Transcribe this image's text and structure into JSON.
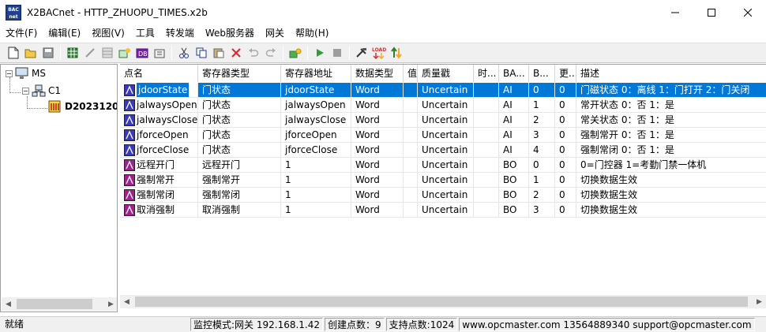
{
  "window": {
    "icon_text": "BAC net",
    "title": "X2BACnet - HTTP_ZHUOPU_TIMES.x2b"
  },
  "menu": [
    "文件(F)",
    "编辑(E)",
    "视图(V)",
    "工具",
    "转发端",
    "Web服务器",
    "网关",
    "帮助(H)"
  ],
  "toolbar_icons": [
    "new-file-icon",
    "open-folder-icon",
    "save-icon",
    "sep",
    "grid-icon",
    "wand-icon",
    "table-icon",
    "add-device-icon",
    "db-icon",
    "export-icon",
    "sep",
    "cut-icon",
    "copy-icon",
    "paste-icon",
    "delete-icon",
    "undo-icon",
    "redo-icon",
    "sep",
    "monitor-icon",
    "sep",
    "run-icon",
    "stop-icon",
    "sep",
    "tools-icon",
    "load-icon",
    "transfer-icon"
  ],
  "colors": {
    "selection": "#0078d7",
    "ai_icon": "#3a3ab8",
    "bo_icon": "#a02090"
  },
  "tree": {
    "root": "MS",
    "channel": "C1",
    "device": "D2023120"
  },
  "grid": {
    "columns": [
      "点名",
      "寄存器类型",
      "寄存器地址",
      "数据类型",
      "值",
      "质量戳",
      "时...",
      "BA...",
      "B...",
      "更...",
      "描述"
    ],
    "rows": [
      {
        "name": "jdoorState",
        "reg_type": "门状态",
        "reg_addr": "jdoorState",
        "data_type": "Word",
        "value": "",
        "quality": "Uncertain",
        "time": "",
        "ba_type": "AI",
        "ba_inst": "0",
        "update": "0",
        "desc": "门磁状态 0：离线 1：门打开 2：门关闭",
        "icon": "ai"
      },
      {
        "name": "jalwaysOpen",
        "reg_type": "门状态",
        "reg_addr": "jalwaysOpen",
        "data_type": "Word",
        "value": "",
        "quality": "Uncertain",
        "time": "",
        "ba_type": "AI",
        "ba_inst": "1",
        "update": "0",
        "desc": "常开状态 0：否 1：是",
        "icon": "ai"
      },
      {
        "name": "jalwaysClose",
        "reg_type": "门状态",
        "reg_addr": "jalwaysClose",
        "data_type": "Word",
        "value": "",
        "quality": "Uncertain",
        "time": "",
        "ba_type": "AI",
        "ba_inst": "2",
        "update": "0",
        "desc": "常关状态 0：否 1：是",
        "icon": "ai"
      },
      {
        "name": "jforceOpen",
        "reg_type": "门状态",
        "reg_addr": "jforceOpen",
        "data_type": "Word",
        "value": "",
        "quality": "Uncertain",
        "time": "",
        "ba_type": "AI",
        "ba_inst": "3",
        "update": "0",
        "desc": "强制常开 0：否 1：是",
        "icon": "ai"
      },
      {
        "name": "jforceClose",
        "reg_type": "门状态",
        "reg_addr": "jforceClose",
        "data_type": "Word",
        "value": "",
        "quality": "Uncertain",
        "time": "",
        "ba_type": "AI",
        "ba_inst": "4",
        "update": "0",
        "desc": "强制常闭 0：否 1：是",
        "icon": "ai"
      },
      {
        "name": "远程开门",
        "reg_type": "远程开门",
        "reg_addr": "1",
        "data_type": "Word",
        "value": "",
        "quality": "Uncertain",
        "time": "",
        "ba_type": "BO",
        "ba_inst": "0",
        "update": "0",
        "desc": "0=门控器 1=考勤门禁一体机",
        "icon": "bo"
      },
      {
        "name": "强制常开",
        "reg_type": "强制常开",
        "reg_addr": "1",
        "data_type": "Word",
        "value": "",
        "quality": "Uncertain",
        "time": "",
        "ba_type": "BO",
        "ba_inst": "1",
        "update": "0",
        "desc": "切换数据生效",
        "icon": "bo"
      },
      {
        "name": "强制常闭",
        "reg_type": "强制常闭",
        "reg_addr": "1",
        "data_type": "Word",
        "value": "",
        "quality": "Uncertain",
        "time": "",
        "ba_type": "BO",
        "ba_inst": "2",
        "update": "0",
        "desc": "切换数据生效",
        "icon": "bo"
      },
      {
        "name": "取消强制",
        "reg_type": "取消强制",
        "reg_addr": "1",
        "data_type": "Word",
        "value": "",
        "quality": "Uncertain",
        "time": "",
        "ba_type": "BO",
        "ba_inst": "3",
        "update": "0",
        "desc": "切换数据生效",
        "icon": "bo"
      }
    ]
  },
  "status": {
    "ready": "就绪",
    "monitor": "监控模式:网关 192.168.1.42",
    "created": "创建点数：9",
    "supported": "支持点数:1024",
    "contact": "www.opcmaster.com 13564889340 support@opcmaster.com"
  }
}
